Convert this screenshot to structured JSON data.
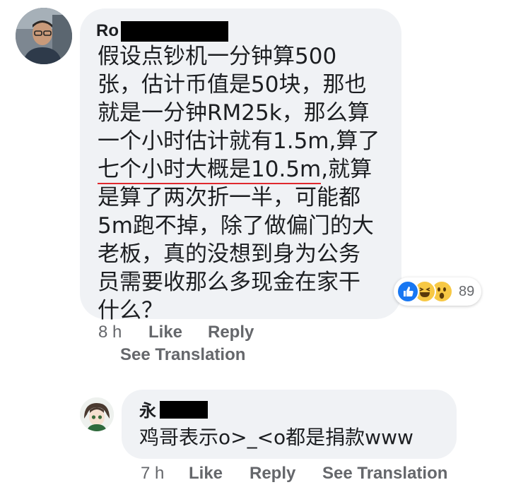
{
  "colors": {
    "bubble": "#f0f2f5",
    "meta_text": "#65676b",
    "like_blue": "#1877f2",
    "emoji_yellow": "#f7c844",
    "underline_red": "#e0282e"
  },
  "comments": [
    {
      "author_visible": "Ro",
      "author_redacted": true,
      "body_lines": [
        "假设点钞机一分钟算500",
        "张，估计币值是50块，那也",
        "就是一分钟RM25k，那么算",
        "一个小时估计就有1.5m,算了"
      ],
      "underlined_text": "七个小时大概是10.5m",
      "line5_rest": ",就算",
      "body_lines_after": [
        "是算了两次折一半，可能都",
        "5m跑不掉，除了做偏门的大",
        "老板，真的没想到身为公务",
        "员需要收那么多现金在家干",
        "什么？"
      ],
      "reactions": {
        "icons": [
          "like-icon",
          "haha-icon",
          "wow-icon"
        ],
        "count": "89"
      },
      "time": "8 h",
      "like_label": "Like",
      "reply_label": "Reply",
      "see_translation_label": "See Translation"
    },
    {
      "author_visible": "永",
      "author_redacted": true,
      "body": "鸡哥表示o>_<o都是捐款www",
      "time": "7 h",
      "like_label": "Like",
      "reply_label": "Reply",
      "see_translation_label": "See Translation"
    }
  ]
}
